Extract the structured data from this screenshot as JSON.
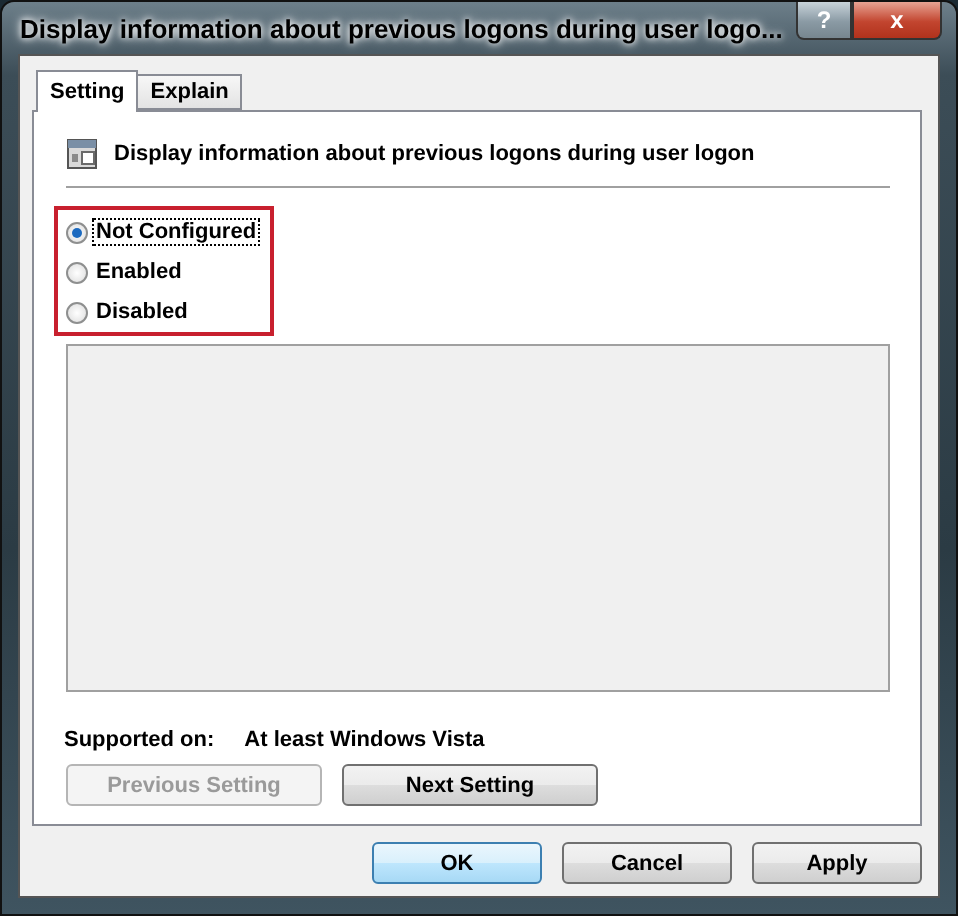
{
  "window": {
    "title": "Display information about previous logons during user logo..."
  },
  "title_buttons": [
    {
      "label": "?",
      "kind": "help"
    },
    {
      "label": "x",
      "kind": "close"
    }
  ],
  "tabs": [
    {
      "label": "Setting",
      "selected": true
    },
    {
      "label": "Explain",
      "selected": false
    }
  ],
  "policy": {
    "name": "Display information about previous logons during user logon"
  },
  "options": [
    {
      "label": "Not Configured",
      "selected": true,
      "focused": true
    },
    {
      "label": "Enabled",
      "selected": false,
      "focused": false
    },
    {
      "label": "Disabled",
      "selected": false,
      "focused": false
    }
  ],
  "supported": {
    "label": "Supported on:",
    "value": "At least Windows Vista"
  },
  "nav_buttons": [
    {
      "label": "Previous Setting",
      "disabled": true
    },
    {
      "label": "Next Setting",
      "disabled": false
    }
  ],
  "buttons": [
    {
      "label": "OK",
      "default": true
    },
    {
      "label": "Cancel",
      "default": false
    },
    {
      "label": "Apply",
      "default": false
    }
  ]
}
